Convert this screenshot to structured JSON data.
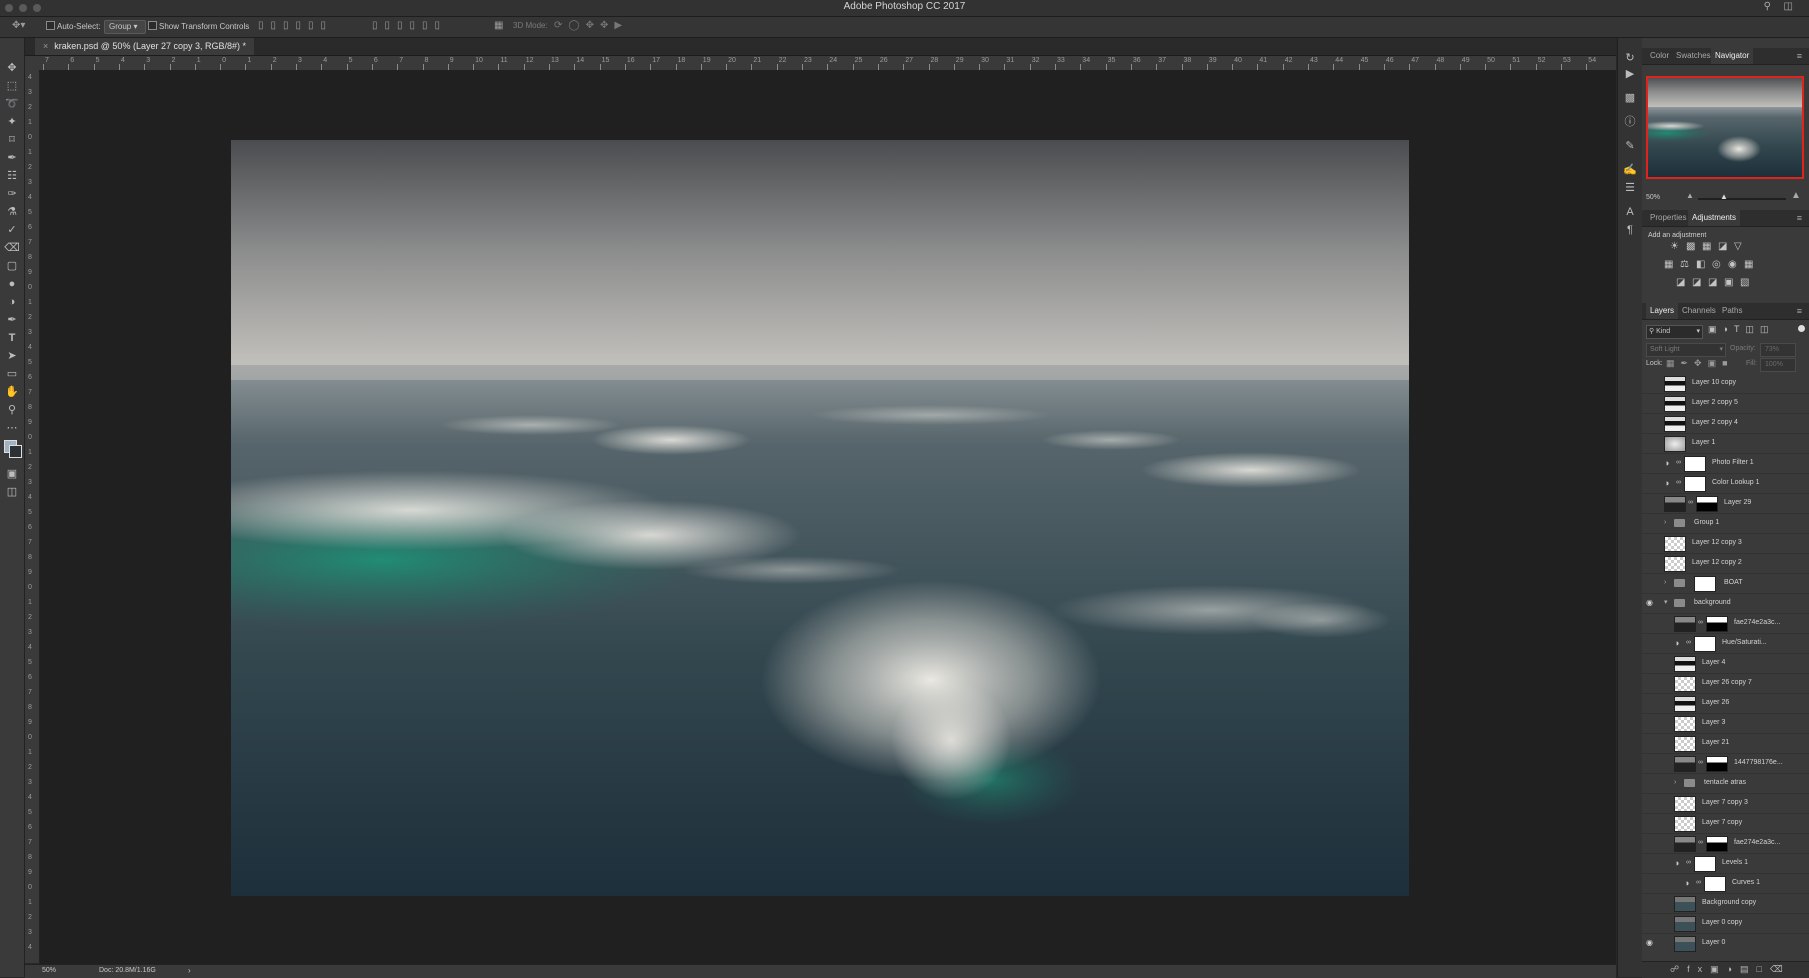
{
  "window": {
    "title": "Adobe Photoshop CC 2017"
  },
  "options": {
    "auto_select_label": "Auto-Select:",
    "auto_select_value": "Group",
    "show_transform_label": "Show Transform Controls",
    "mode_3d_label": "3D Mode:"
  },
  "document": {
    "tab_label": "kraken.psd @ 50% (Layer 27 copy 3, RGB/8#) *",
    "zoom": "50%",
    "doc_info": "Doc: 20.8M/1.16G"
  },
  "ruler": {
    "h_ticks": [
      "7",
      "6",
      "5",
      "4",
      "3",
      "2",
      "1",
      "0",
      "1",
      "2",
      "3",
      "4",
      "5",
      "6",
      "7",
      "8",
      "9",
      "10",
      "11",
      "12",
      "13",
      "14",
      "15",
      "16",
      "17",
      "18",
      "19",
      "20",
      "21",
      "22",
      "23",
      "24",
      "25",
      "26",
      "27",
      "28",
      "29",
      "30",
      "31",
      "32",
      "33",
      "34",
      "35",
      "36",
      "37",
      "38",
      "39",
      "40",
      "41",
      "42",
      "43",
      "44",
      "45",
      "46",
      "47",
      "48",
      "49",
      "50",
      "51",
      "52",
      "53",
      "54"
    ],
    "v_ticks": [
      "4",
      "3",
      "2",
      "1",
      "0",
      "1",
      "2",
      "3",
      "4",
      "5",
      "6",
      "7",
      "8",
      "9",
      "0",
      "1",
      "2",
      "3",
      "4",
      "5",
      "6",
      "7",
      "8",
      "9",
      "0",
      "1",
      "2",
      "3",
      "4",
      "5",
      "6",
      "7",
      "8",
      "9",
      "0",
      "1",
      "2",
      "3",
      "4",
      "5",
      "6",
      "7",
      "8",
      "9",
      "0",
      "1",
      "2",
      "3",
      "4",
      "5",
      "6",
      "7",
      "8",
      "9",
      "0",
      "1",
      "2",
      "3",
      "4"
    ]
  },
  "panels": {
    "top_tabs": [
      "Color",
      "Swatches",
      "Navigator"
    ],
    "navigator_zoom": "50%",
    "mid_tabs": [
      "Properties",
      "Adjustments"
    ],
    "add_adjustment": "Add an adjustment",
    "layers_tabs": [
      "Layers",
      "Channels",
      "Paths"
    ],
    "kind_filter": "Kind",
    "blend_mode": "Soft Light",
    "opacity_label": "Opacity:",
    "opacity_value": "73%",
    "lock_label": "Lock:",
    "fill_label": "Fill:",
    "fill_value": "100%"
  },
  "layers": [
    {
      "name": "Layer 10 copy",
      "indent": 0,
      "type": "dark"
    },
    {
      "name": "Layer 2 copy 5",
      "indent": 0,
      "type": "dark"
    },
    {
      "name": "Layer 2 copy 4",
      "indent": 0,
      "type": "dark"
    },
    {
      "name": "Layer 1",
      "indent": 0,
      "type": "gray"
    },
    {
      "name": "Photo Filter 1",
      "indent": 0,
      "type": "adj"
    },
    {
      "name": "Color Lookup 1",
      "indent": 0,
      "type": "adj"
    },
    {
      "name": "Layer 29",
      "indent": 0,
      "type": "mask"
    },
    {
      "name": "Group 1",
      "indent": 0,
      "type": "group"
    },
    {
      "name": "Layer 12 copy 3",
      "indent": 0,
      "type": "check"
    },
    {
      "name": "Layer 12 copy 2",
      "indent": 0,
      "type": "check"
    },
    {
      "name": "BOAT",
      "indent": 0,
      "type": "group"
    },
    {
      "name": "background",
      "indent": 0,
      "type": "group",
      "visible": true
    },
    {
      "name": "fae274e2a3c...",
      "indent": 1,
      "type": "mask"
    },
    {
      "name": "Hue/Saturati...",
      "indent": 1,
      "type": "adj"
    },
    {
      "name": "Layer 4",
      "indent": 1,
      "type": "dark"
    },
    {
      "name": "Layer 26 copy 7",
      "indent": 1,
      "type": "check"
    },
    {
      "name": "Layer 26",
      "indent": 1,
      "type": "dark"
    },
    {
      "name": "Layer 3",
      "indent": 1,
      "type": "check"
    },
    {
      "name": "Layer 21",
      "indent": 1,
      "type": "check"
    },
    {
      "name": "1447798176e...",
      "indent": 1,
      "type": "mask"
    },
    {
      "name": "tentacle atras",
      "indent": 1,
      "type": "group"
    },
    {
      "name": "Layer 7 copy 3",
      "indent": 1,
      "type": "check"
    },
    {
      "name": "Layer 7 copy",
      "indent": 1,
      "type": "check"
    },
    {
      "name": "fae274e2a3c...",
      "indent": 1,
      "type": "mask"
    },
    {
      "name": "Levels 1",
      "indent": 1,
      "type": "adj"
    },
    {
      "name": "Curves 1",
      "indent": 2,
      "type": "adj"
    },
    {
      "name": "Background copy",
      "indent": 1,
      "type": "photo"
    },
    {
      "name": "Layer 0 copy",
      "indent": 1,
      "type": "photo"
    },
    {
      "name": "Layer 0",
      "indent": 1,
      "type": "photo",
      "visible": true
    }
  ],
  "colors": {
    "accent_red": "#e0241b",
    "panel_bg": "#3a3a3a",
    "canvas_bg": "#202020"
  }
}
